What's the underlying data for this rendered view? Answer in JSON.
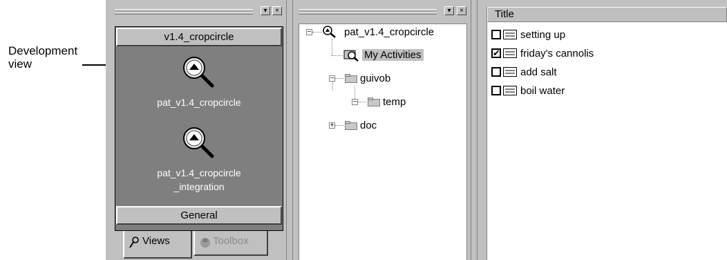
{
  "annotation": {
    "label": "Development\nview",
    "line1": "Development",
    "line2": "view"
  },
  "views_panel": {
    "groups": [
      {
        "label": "v1.4_cropcircle"
      },
      {
        "label": "General"
      }
    ],
    "items": [
      {
        "label": "pat_v1.4_cropcircle",
        "icon": "view-magnifier-icon"
      },
      {
        "label_line1": "pat_v1.4_cropcircle",
        "label_line2": "_integration",
        "icon": "view-magnifier-icon"
      }
    ],
    "tabs": [
      {
        "label": "Views",
        "icon": "wand-icon",
        "active": true
      },
      {
        "label": "Toolbox",
        "icon": "toolbox-icon",
        "active": false
      }
    ]
  },
  "tree_panel": {
    "root": {
      "label": "pat_v1.4_cropcircle",
      "expander": "−"
    },
    "nodes": [
      {
        "label": "My Activities",
        "selected": true
      },
      {
        "label": "guivob",
        "expander": "−"
      },
      {
        "label": "temp",
        "expander": "−"
      },
      {
        "label": "doc",
        "expander": "+"
      }
    ]
  },
  "activity_list": {
    "column_title": "Title",
    "rows": [
      {
        "label": "setting up",
        "checked": false
      },
      {
        "label": "friday's cannolis",
        "checked": true
      },
      {
        "label": "add salt",
        "checked": false
      },
      {
        "label": "boil water",
        "checked": false
      }
    ]
  },
  "titlebar_buttons": {
    "dropdown": "▾",
    "close": "×"
  },
  "colors": {
    "panel_gray": "#c0c0c0",
    "views_background": "#7f7f7f",
    "selection_gray": "#c0c0c0"
  }
}
